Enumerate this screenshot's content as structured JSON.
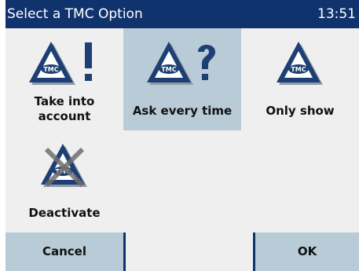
{
  "titlebar": {
    "title": "Select a TMC Option",
    "clock": "13:51",
    "color": "#10336d"
  },
  "options": [
    {
      "label_line1": "Take into",
      "label_line2": "account",
      "icon": "tmc-exclamation-icon",
      "selected": false
    },
    {
      "label": "Ask every time",
      "icon": "tmc-question-icon",
      "selected": true
    },
    {
      "label": "Only show",
      "icon": "tmc-triangle-icon",
      "selected": false
    },
    {
      "label": "Deactivate",
      "icon": "tmc-crossed-out-icon",
      "selected": false
    }
  ],
  "buttons": {
    "cancel_label": "Cancel",
    "ok_label": "OK"
  },
  "icon_text": "TMC",
  "colors": {
    "selection": "#b9cbd6",
    "background": "#efefef",
    "triangle": "#1d3f73"
  }
}
